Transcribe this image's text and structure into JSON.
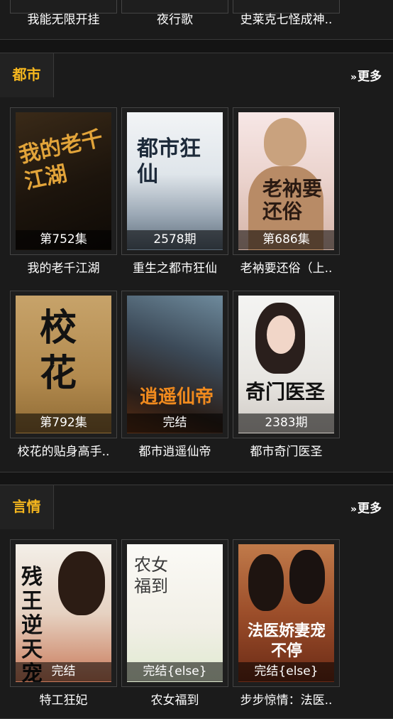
{
  "top_row": {
    "titles": [
      "我能无限开挂",
      "夜行歌",
      "史莱克七怪成神.."
    ]
  },
  "sections": [
    {
      "title": "都市",
      "more_label": "更多",
      "books": [
        {
          "title": "我的老千江湖",
          "badge": "第752集",
          "cover_text": "我的老千江湖"
        },
        {
          "title": "重生之都市狂仙",
          "badge": "2578期",
          "cover_text": "都市狂仙"
        },
        {
          "title": "老衲要还俗（上..",
          "badge": "第686集",
          "cover_text": "老衲要还俗"
        },
        {
          "title": "校花的贴身高手..",
          "badge": "第792集",
          "cover_text": "校花"
        },
        {
          "title": "都市逍遥仙帝",
          "badge": "完结",
          "cover_text": "逍遥仙帝"
        },
        {
          "title": "都市奇门医圣",
          "badge": "2383期",
          "cover_text": "奇门医圣"
        }
      ]
    },
    {
      "title": "言情",
      "more_label": "更多",
      "books": [
        {
          "title": "特工狂妃",
          "badge": "完结",
          "cover_text": "残王逆天宠"
        },
        {
          "title": "农女福到",
          "badge": "完结{else}",
          "cover_text": "农女福到"
        },
        {
          "title": "步步惊情：法医..",
          "badge": "完结{else}",
          "cover_text": "法医娇妻宠不停"
        }
      ]
    }
  ]
}
